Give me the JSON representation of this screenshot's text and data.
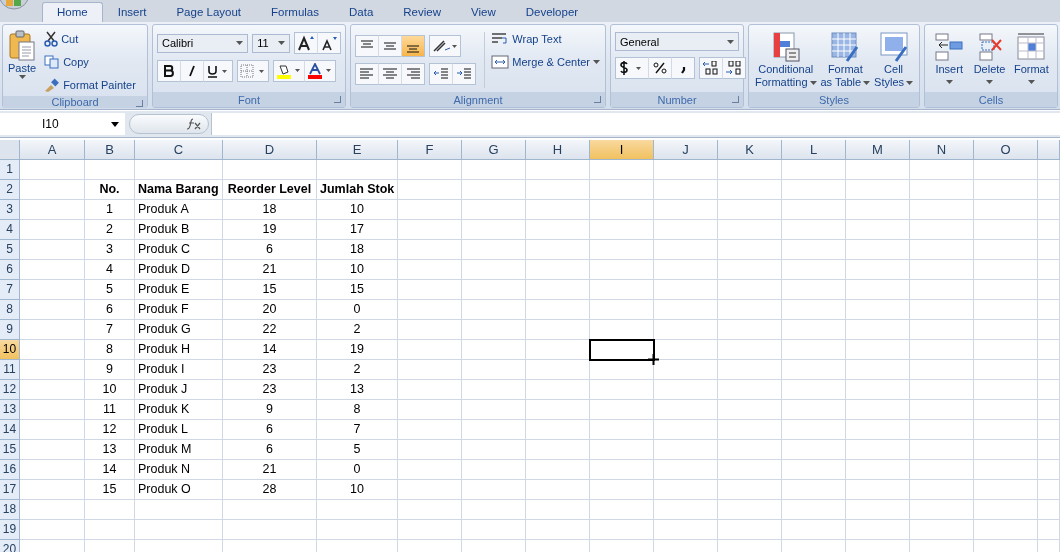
{
  "tabs": [
    {
      "label": "Home",
      "selected": true
    },
    {
      "label": "Insert",
      "selected": false
    },
    {
      "label": "Page Layout",
      "selected": false
    },
    {
      "label": "Formulas",
      "selected": false
    },
    {
      "label": "Data",
      "selected": false
    },
    {
      "label": "Review",
      "selected": false
    },
    {
      "label": "View",
      "selected": false
    },
    {
      "label": "Developer",
      "selected": false
    }
  ],
  "ribbon": {
    "clipboard": {
      "label": "Clipboard",
      "paste": "Paste",
      "cut": "Cut",
      "copy": "Copy",
      "format_painter": "Format Painter"
    },
    "font": {
      "label": "Font",
      "font_name": "Calibri",
      "font_size": "11"
    },
    "alignment": {
      "label": "Alignment",
      "wrap_text": "Wrap Text",
      "merge_center": "Merge & Center",
      "vertical_align": [
        {
          "kind": "top",
          "selected": false
        },
        {
          "kind": "middle",
          "selected": false
        },
        {
          "kind": "bottom",
          "selected": true
        }
      ]
    },
    "number": {
      "label": "Number",
      "format": "General"
    },
    "styles": {
      "label": "Styles",
      "buttons": [
        {
          "kind": "conditional",
          "lines": [
            "Conditional",
            "Formatting"
          ]
        },
        {
          "kind": "table",
          "lines": [
            "Format",
            "as Table"
          ]
        },
        {
          "kind": "cellstyles",
          "lines": [
            "Cell",
            "Styles"
          ]
        }
      ]
    },
    "cells": {
      "label": "Cells",
      "buttons": [
        {
          "kind": "insert",
          "lines": [
            "Insert"
          ]
        },
        {
          "kind": "delete",
          "lines": [
            "Delete"
          ]
        },
        {
          "kind": "format",
          "lines": [
            "Format"
          ]
        }
      ]
    }
  },
  "name_box": "I10",
  "sheet": {
    "columns": [
      {
        "label": "A",
        "selected": false
      },
      {
        "label": "B",
        "selected": false
      },
      {
        "label": "C",
        "selected": false
      },
      {
        "label": "D",
        "selected": false
      },
      {
        "label": "E",
        "selected": false
      },
      {
        "label": "F",
        "selected": false
      },
      {
        "label": "G",
        "selected": false
      },
      {
        "label": "H",
        "selected": false
      },
      {
        "label": "I",
        "selected": true
      },
      {
        "label": "J",
        "selected": false
      },
      {
        "label": "K",
        "selected": false
      },
      {
        "label": "L",
        "selected": false
      },
      {
        "label": "M",
        "selected": false
      },
      {
        "label": "N",
        "selected": false
      },
      {
        "label": "O",
        "selected": false
      }
    ],
    "rows": [
      {
        "label": "1",
        "selected": false
      },
      {
        "label": "2",
        "selected": false
      },
      {
        "label": "3",
        "selected": false
      },
      {
        "label": "4",
        "selected": false
      },
      {
        "label": "5",
        "selected": false
      },
      {
        "label": "6",
        "selected": false
      },
      {
        "label": "7",
        "selected": false
      },
      {
        "label": "8",
        "selected": false
      },
      {
        "label": "9",
        "selected": false
      },
      {
        "label": "10",
        "selected": true
      },
      {
        "label": "11",
        "selected": false
      },
      {
        "label": "12",
        "selected": false
      },
      {
        "label": "13",
        "selected": false
      },
      {
        "label": "14",
        "selected": false
      },
      {
        "label": "15",
        "selected": false
      },
      {
        "label": "16",
        "selected": false
      },
      {
        "label": "17",
        "selected": false
      },
      {
        "label": "18",
        "selected": false
      },
      {
        "label": "19",
        "selected": false
      },
      {
        "label": "20",
        "selected": false
      }
    ],
    "table": {
      "columns": [
        "No.",
        "Nama Barang",
        "Reorder Level",
        "Jumlah Stok"
      ],
      "rows": [
        [
          "1",
          "Produk A",
          "18",
          "10"
        ],
        [
          "2",
          "Produk B",
          "19",
          "17"
        ],
        [
          "3",
          "Produk C",
          "6",
          "18"
        ],
        [
          "4",
          "Produk D",
          "21",
          "10"
        ],
        [
          "5",
          "Produk E",
          "15",
          "15"
        ],
        [
          "6",
          "Produk F",
          "20",
          "0"
        ],
        [
          "7",
          "Produk G",
          "22",
          "2"
        ],
        [
          "8",
          "Produk H",
          "14",
          "19"
        ],
        [
          "9",
          "Produk I",
          "23",
          "2"
        ],
        [
          "10",
          "Produk J",
          "23",
          "13"
        ],
        [
          "11",
          "Produk K",
          "9",
          "8"
        ],
        [
          "12",
          "Produk L",
          "6",
          "7"
        ],
        [
          "13",
          "Produk M",
          "6",
          "5"
        ],
        [
          "14",
          "Produk N",
          "21",
          "0"
        ],
        [
          "15",
          "Produk O",
          "28",
          "10"
        ]
      ]
    }
  }
}
